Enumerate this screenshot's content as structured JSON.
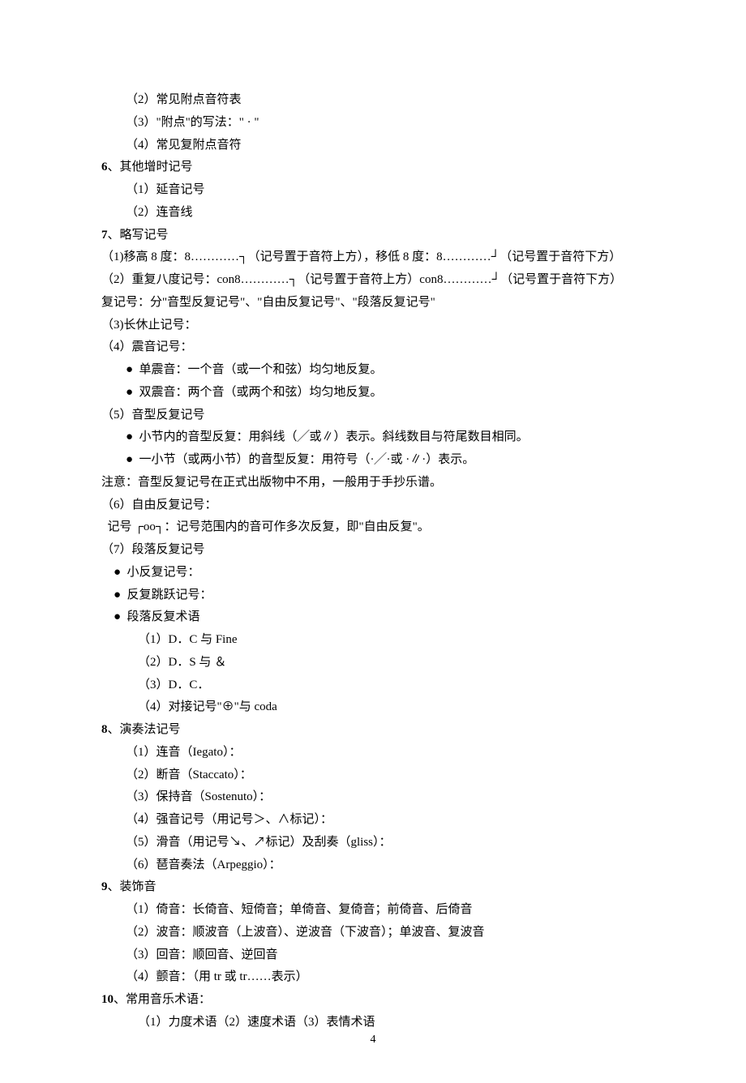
{
  "lines": {
    "l1": "（2）常见附点音符表",
    "l2": "（3）\"附点\"的写法：\" · \"",
    "l3": "（4）常见复附点音符",
    "s6_num": "6",
    "s6": "、其他增时记号",
    "l4": "（1）延音记号",
    "l5": "（2）连音线",
    "s7_num": "7",
    "s7": "、略写记号",
    "l6": "（1)移高 8 度：8…………┐（记号置于音符上方），移低 8 度：8…………┘（记号置于音符下方）",
    "l7": "（2）重复八度记号：con8…………┐（记号置于音符上方）con8…………┘（记号置于音符下方）",
    "l8": "复记号：分\"音型反复记号\"、\"自由反复记号\"、\"段落反复记号\"",
    "l9": "（3)长休止记号：",
    "l10": "（4）震音记号：",
    "b1": "●  单震音：一个音（或一个和弦）均匀地反复。",
    "b2": "●  双震音：两个音（或两个和弦）均匀地反复。",
    "l11": "（5）音型反复记号",
    "b3": "●  小节内的音型反复：用斜线（╱或∥）表示。斜线数目与符尾数目相同。",
    "b4": "●  一小节（或两小节）的音型反复：用符号（·╱·或 ·∥·）表示。",
    "l12": "注意：音型反复记号在正式出版物中不用，一般用于手抄乐谱。",
    "l13": "（6）自由反复记号：",
    "l14": "  记号 ┌oo┐：记号范围内的音可作多次反复，即\"自由反复\"。",
    "l15": "（7）段落反复记号",
    "b5": "●  小反复记号：",
    "b6": "●  反复跳跃记号：",
    "b7": "●  段落反复术语",
    "l16": "（1）D．C 与 Fine",
    "l17": "（2）D．S 与 ",
    "l17s": "＆",
    "l18": "（3）D．C．",
    "l19": "（4）对接记号\"⊕\"与 coda",
    "s8_num": "8",
    "s8": "、演奏法记号",
    "l20": "（1）连音（Iegato）：",
    "l21": "（2）断音（Staccato）：",
    "l22": "（3）保持音（Sostenuto）：",
    "l23": "（4）强音记号（用记号＞、∧标记）：",
    "l24": "（5）滑音（用记号↘、↗标记）及刮奏（gliss）：",
    "l25": "（6）琶音奏法（Arpeggio）：",
    "s9_num": "9",
    "s9": "、装饰音",
    "l26": "（1）倚音：长倚音、短倚音；单倚音、复倚音；前倚音、后倚音",
    "l27": "（2）波音：顺波音（上波音）、逆波音（下波音）；单波音、复波音",
    "l28": "（3）回音：顺回音、逆回音",
    "l29": "（4）颤音：（用 tr 或 tr……表示）",
    "s10_num": "10",
    "s10": "、常用音乐术语：",
    "l30": "（1）力度术语（2）速度术语（3）表情术语"
  },
  "page_number": "4"
}
